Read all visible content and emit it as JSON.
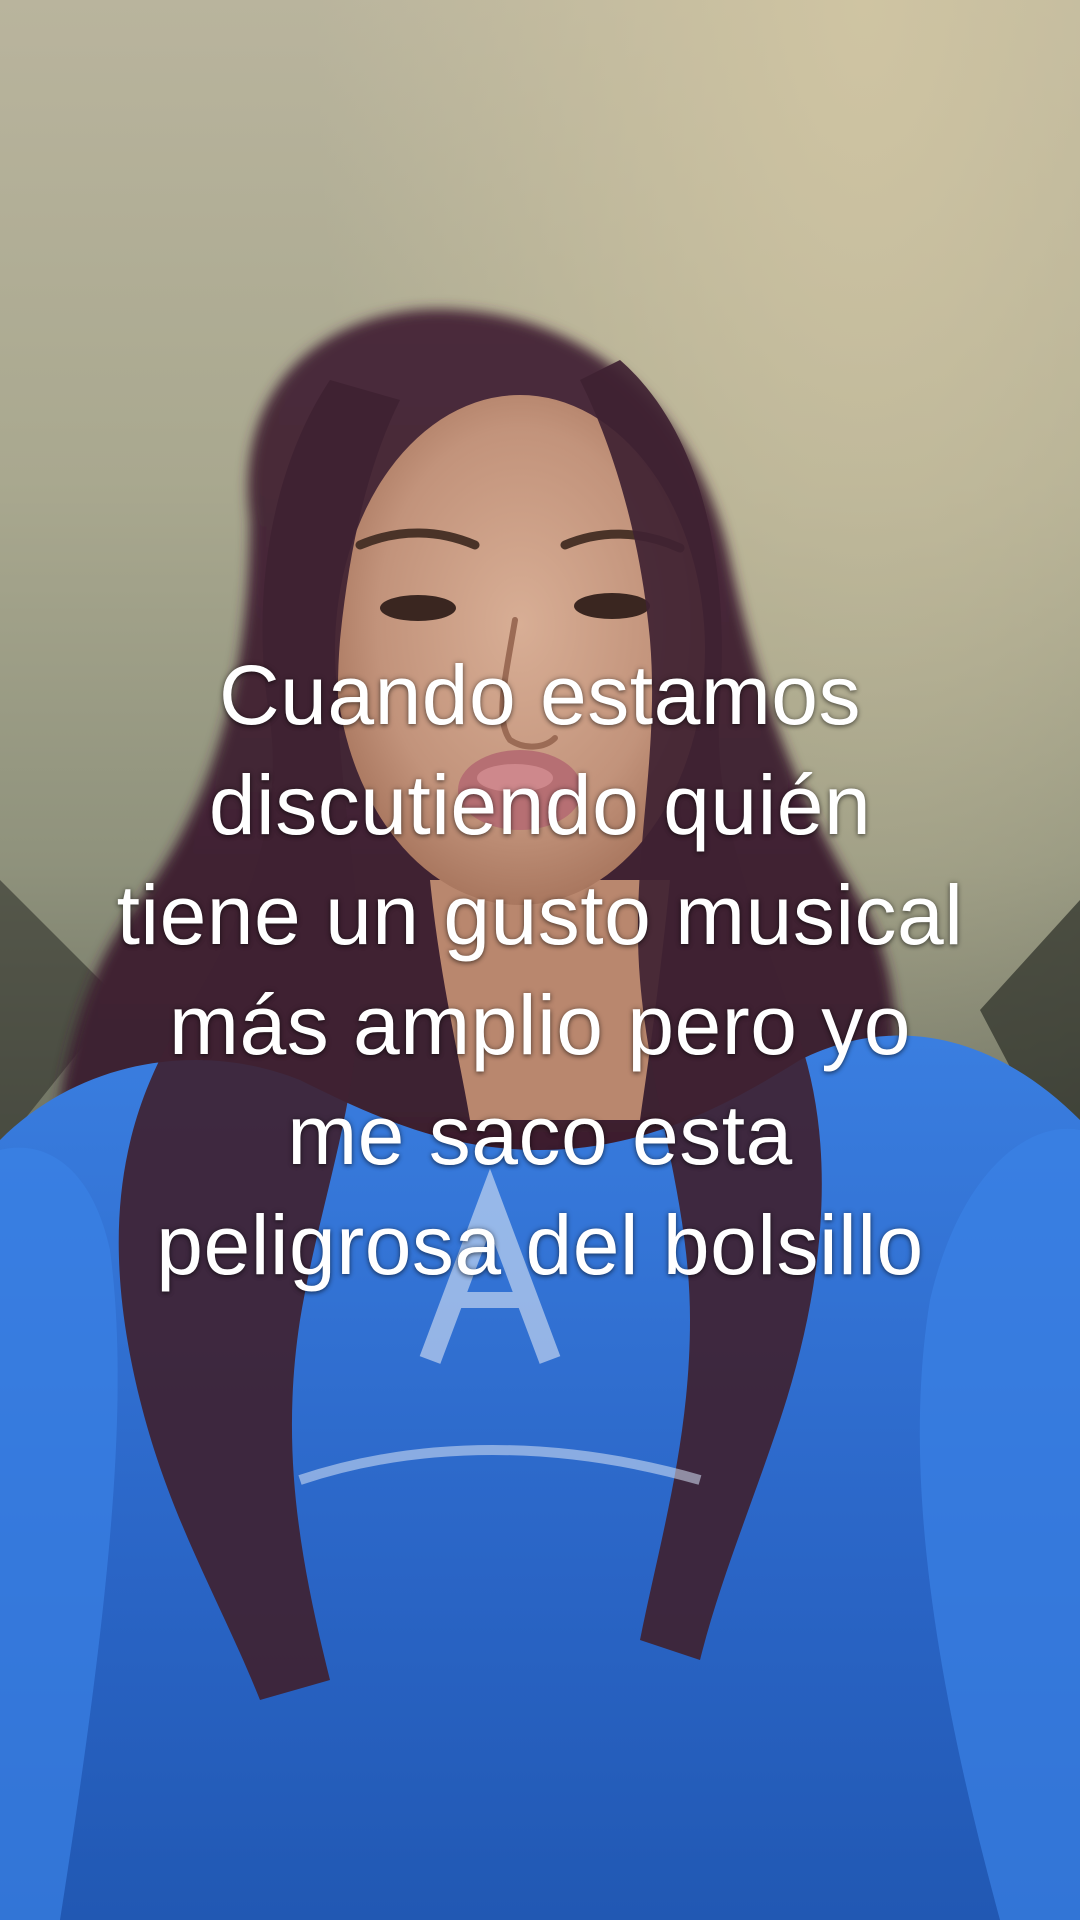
{
  "caption": {
    "lines": [
      "Cuando estamos",
      "discutiendo quién",
      "tiene un gusto musical",
      "más amplio pero yo",
      "me saco esta",
      "peligrosa del bolsillo"
    ]
  },
  "scene": {
    "subject": "person-with-long-purple-hair",
    "colors": {
      "wall_top": "#b9b49d",
      "wall_bottom": "#3a3c36",
      "hair": "#4a2a3c",
      "skin": "#c79a82",
      "hoodie": "#2f6fd0",
      "caption_text": "#ffffff"
    }
  }
}
